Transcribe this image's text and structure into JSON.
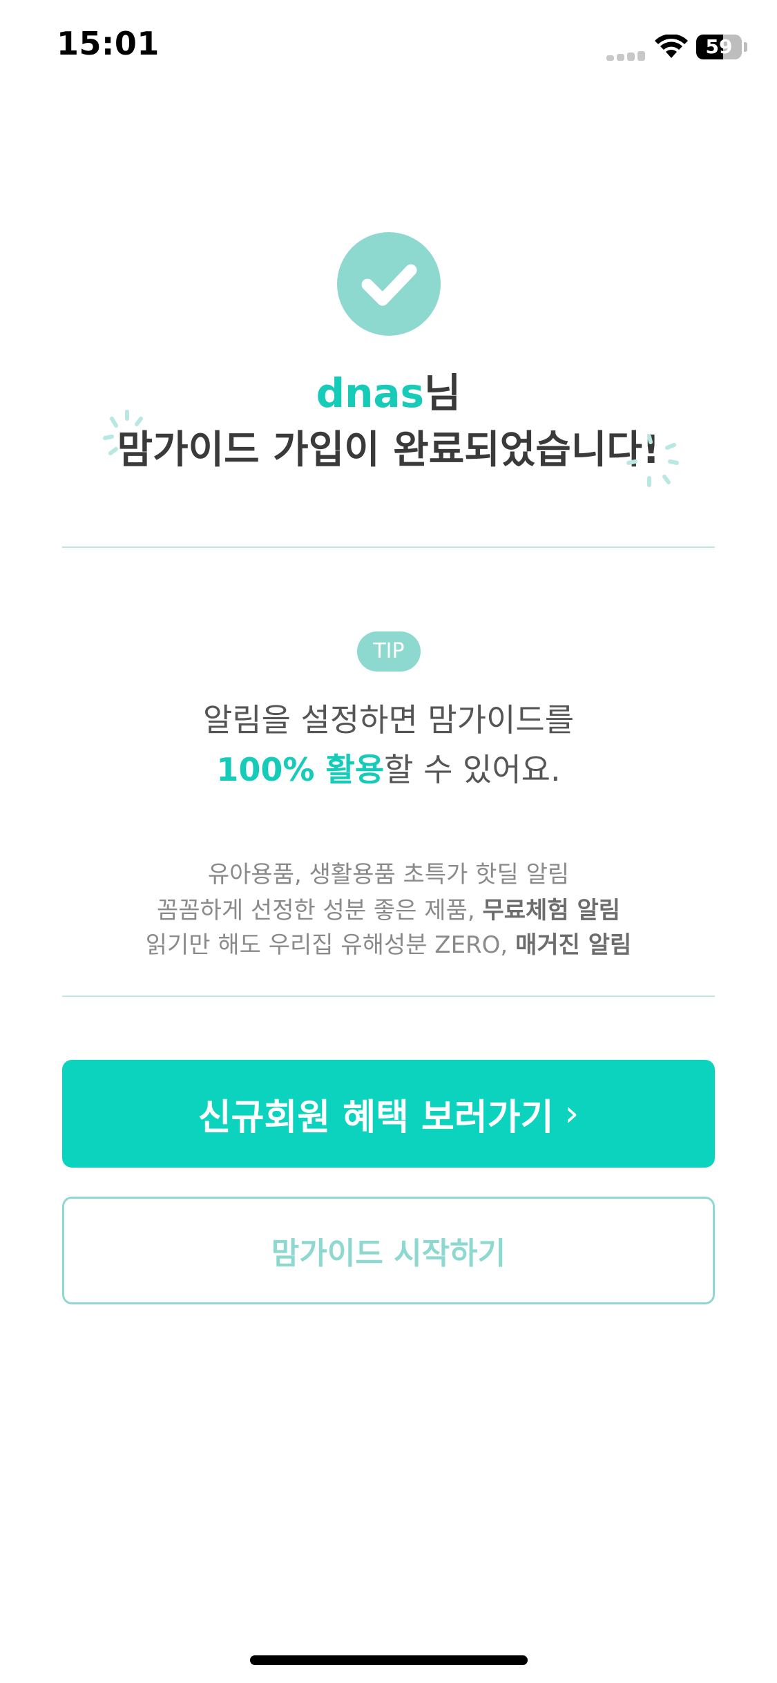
{
  "status_bar": {
    "time": "15:01",
    "battery_level": "59",
    "icons": [
      "cellular-signal-icon",
      "wifi-icon",
      "battery-icon"
    ]
  },
  "success": {
    "icon": "check-icon",
    "username": "dnas",
    "honorific": "님",
    "message": "맘가이드 가입이 완료되었습니다!"
  },
  "tip": {
    "badge": "TIP",
    "line1": "알림을 설정하면 맘가이드를",
    "line2_highlight": "100% 활용",
    "line2_rest": "할 수 있어요."
  },
  "features": [
    {
      "text": "유아용품, 생활용품 초특가 핫딜 ",
      "strong": "알림"
    },
    {
      "text": "꼼꼼하게 선정한 성분 좋은 제품, ",
      "strong": "무료체험 알림"
    },
    {
      "text": "읽기만 해도 우리집 유해성분 ZERO, ",
      "strong": "매거진 알림"
    }
  ],
  "buttons": {
    "primary_label": "신규회원 혜택 보러가기",
    "primary_chevron": "›",
    "secondary_label": "맘가이드 시작하기"
  },
  "colors": {
    "accent": "#0cd3bd",
    "accent_text": "#16cbb8",
    "accent_soft": "#8ed9cf",
    "divider": "#bfe5e0"
  }
}
